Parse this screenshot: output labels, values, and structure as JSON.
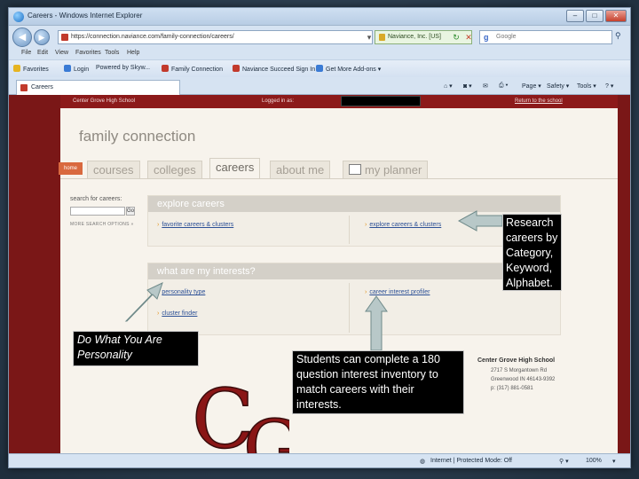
{
  "window": {
    "title": "Careers - Windows Internet Explorer",
    "buttons": {
      "minimize": "–",
      "maximize": "□",
      "close": "✕"
    }
  },
  "address_bar": {
    "url": "https://connection.naviance.com/family-connection/careers/",
    "security_label": "Naviance, Inc. [US]",
    "search_placeholder": "Google"
  },
  "menu": [
    "File",
    "Edit",
    "View",
    "Favorites",
    "Tools",
    "Help"
  ],
  "favorites_bar": {
    "favorites_label": "Favorites",
    "items": [
      "Login",
      "Powered by Skyw...",
      "Family Connection",
      "Naviance Succeed Sign In",
      "Get More Add-ons"
    ]
  },
  "tab": {
    "label": "Careers"
  },
  "command_bar": [
    "Page",
    "Safety",
    "Tools"
  ],
  "site": {
    "school_header": "Center Grove High School",
    "logged_in_label": "Logged in as:",
    "return_link": "Return to the school",
    "brand": "family connection",
    "home_tab": "home",
    "tabs": [
      "courses",
      "colleges",
      "careers",
      "about me",
      "my planner"
    ],
    "active_tab": "careers",
    "search_label": "search for careers:",
    "go_label": "Go",
    "more_search_label": "MORE SEARCH OPTIONS »",
    "explore_panel": {
      "heading": "explore careers",
      "left_link": "favorite careers & clusters",
      "right_link": "explore careers & clusters"
    },
    "interests_panel": {
      "heading": "what are my interests?",
      "left_links": [
        "personality type",
        "cluster finder"
      ],
      "right_link": "career interest profiler"
    },
    "footer_school": {
      "name": "Center Grove High School",
      "lines": [
        "2717 S Morgantown Rd",
        "Greenwood IN 46143-9392",
        "p: (317) 881-0581"
      ]
    }
  },
  "status_bar": {
    "zone": "Internet | Protected Mode: Off",
    "zoom": "100%"
  },
  "annotations": {
    "research": "Research careers by Category, Keyword, Alphabet.",
    "personality": "Do What You Are Personality",
    "students": "Students can complete a 180 question interest inventory to match careers with their interests."
  },
  "colors": {
    "page_background": "#7a1717",
    "arrow": "#b8c8c8",
    "callout_background": "#000000",
    "link": "#2c5096",
    "home_tab": "#d9693f"
  }
}
